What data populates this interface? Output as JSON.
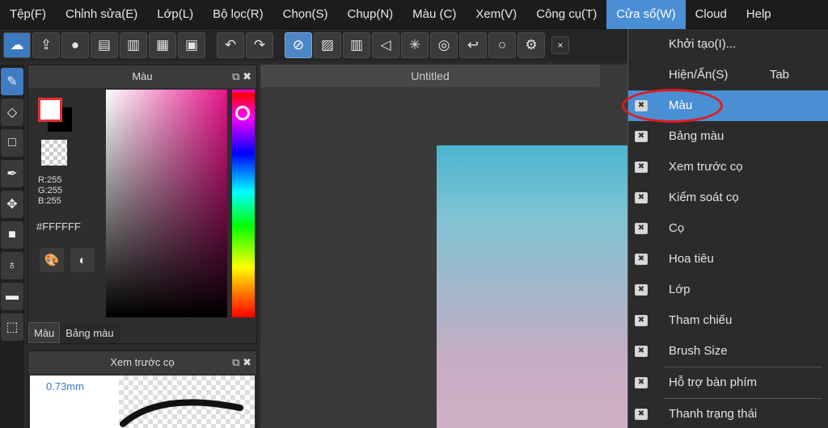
{
  "menubar": {
    "items": [
      "Tệp(F)",
      "Chỉnh sửa(E)",
      "Lớp(L)",
      "Bộ lọc(R)",
      "Chọn(S)",
      "Chụp(N)",
      "Màu (C)",
      "Xem(V)",
      "Công cụ(T)",
      "Cửa sổ(W)",
      "Cloud",
      "Help"
    ]
  },
  "toolbar": {
    "icons": [
      "cloud-upload-icon",
      "export-icon",
      "chat-icon",
      "comment-icon",
      "page-icon",
      "layers-icon",
      "grid-add-icon",
      "undo-icon",
      "redo-icon",
      "no-snap-icon",
      "parallel-snap-icon",
      "grid-snap-icon",
      "perspective-snap-icon",
      "radial-snap-icon",
      "concentric-snap-icon",
      "curve-snap-icon",
      "circle-snap-icon",
      "settings-icon"
    ],
    "close": "×"
  },
  "left_tools": [
    "brush-tool-icon",
    "eraser-tool-icon",
    "select-rect-icon",
    "pen-tool-icon",
    "move-tool-icon",
    "fill-rect-icon",
    "bucket-tool-icon",
    "gradient-tool-icon",
    "lasso-tool-icon"
  ],
  "color_panel": {
    "title": "Màu",
    "r": "R:255",
    "g": "G:255",
    "b": "B:255",
    "hex": "#FFFFFF",
    "tabs": [
      "Màu",
      "Bảng màu"
    ]
  },
  "brush_panel": {
    "title": "Xem trước cọ",
    "size": "0.73mm"
  },
  "canvas": {
    "tab": "Untitled"
  },
  "window_menu": {
    "items": [
      {
        "label": "Khởi tạo(I)...",
        "check": false
      },
      {
        "label": "Hiện/Ẩn(S)",
        "shortcut": "Tab",
        "check": false
      },
      {
        "label": "Màu",
        "check": true,
        "highlight": true
      },
      {
        "label": "Bảng màu",
        "check": true
      },
      {
        "label": "Xem trước cọ",
        "check": true
      },
      {
        "label": "Kiểm soát cọ",
        "check": true
      },
      {
        "label": "Cọ",
        "check": true
      },
      {
        "label": "Hoa tiêu",
        "check": true
      },
      {
        "label": "Lớp",
        "check": true
      },
      {
        "label": "Tham chiếu",
        "check": true
      },
      {
        "label": "Brush Size",
        "check": true
      },
      {
        "label": "Hỗ trợ bàn phím",
        "check": true
      },
      {
        "label": "Thanh trạng thái",
        "check": true
      }
    ]
  },
  "colors": {
    "accent": "#4a8fd4",
    "annotation": "#e01b1b"
  }
}
